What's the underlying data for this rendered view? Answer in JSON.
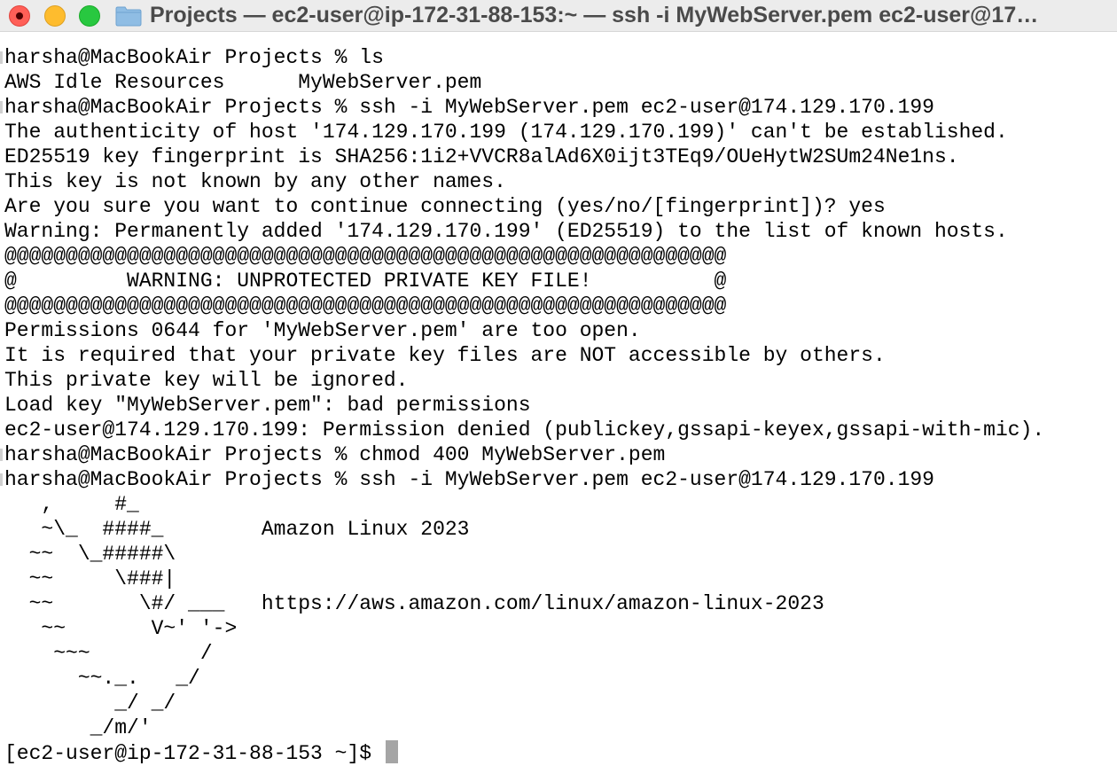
{
  "window": {
    "title": "Projects — ec2-user@ip-172-31-88-153:~ — ssh -i MyWebServer.pem ec2-user@17…",
    "colors": {
      "close": "#ff5f57",
      "minimize": "#febc2e",
      "maximize": "#28c840",
      "folder": "#8fbde4"
    },
    "icons": [
      "close-icon",
      "folder-icon"
    ]
  },
  "terminal": {
    "lines": [
      "harsha@MacBookAir Projects % ls",
      "AWS Idle Resources      MyWebServer.pem",
      "harsha@MacBookAir Projects % ssh -i MyWebServer.pem ec2-user@174.129.170.199",
      "The authenticity of host '174.129.170.199 (174.129.170.199)' can't be established.",
      "ED25519 key fingerprint is SHA256:1i2+VVCR8alAd6X0ijt3TEq9/OUeHytW2SUm24Ne1ns.",
      "This key is not known by any other names.",
      "Are you sure you want to continue connecting (yes/no/[fingerprint])? yes",
      "Warning: Permanently added '174.129.170.199' (ED25519) to the list of known hosts.",
      "@@@@@@@@@@@@@@@@@@@@@@@@@@@@@@@@@@@@@@@@@@@@@@@@@@@@@@@@@@@",
      "@         WARNING: UNPROTECTED PRIVATE KEY FILE!          @",
      "@@@@@@@@@@@@@@@@@@@@@@@@@@@@@@@@@@@@@@@@@@@@@@@@@@@@@@@@@@@",
      "Permissions 0644 for 'MyWebServer.pem' are too open.",
      "It is required that your private key files are NOT accessible by others.",
      "This private key will be ignored.",
      "Load key \"MyWebServer.pem\": bad permissions",
      "ec2-user@174.129.170.199: Permission denied (publickey,gssapi-keyex,gssapi-with-mic).",
      "harsha@MacBookAir Projects % chmod 400 MyWebServer.pem",
      "harsha@MacBookAir Projects % ssh -i MyWebServer.pem ec2-user@174.129.170.199",
      "   ,     #_",
      "   ~\\_  ####_        Amazon Linux 2023",
      "  ~~  \\_#####\\",
      "  ~~     \\###|",
      "  ~~       \\#/ ___   https://aws.amazon.com/linux/amazon-linux-2023",
      "   ~~       V~' '->",
      "    ~~~         /",
      "      ~~._.   _/",
      "         _/ _/",
      "       _/m/'"
    ],
    "prompt": "[ec2-user@ip-172-31-88-153 ~]$ ",
    "cursor_color": "#a5a5a5"
  }
}
